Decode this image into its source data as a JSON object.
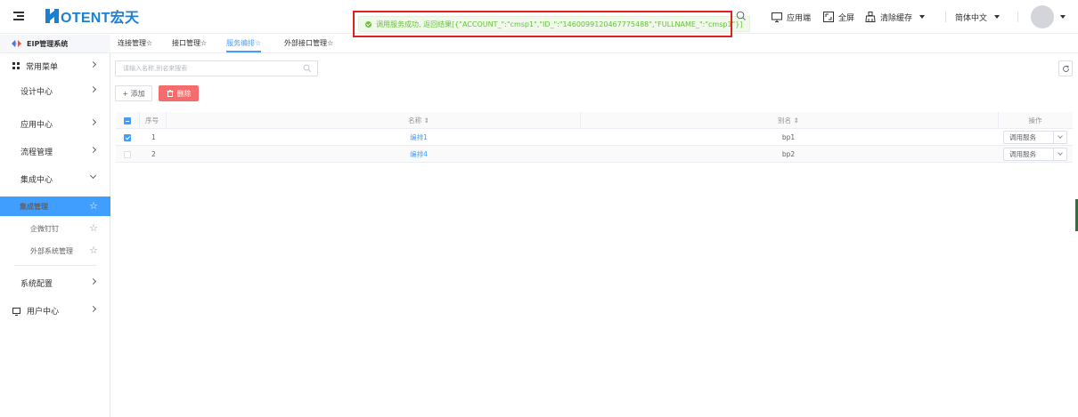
{
  "header": {
    "logo_text": "OTENT宏天",
    "toast_text": "调用服务成功, 返回结果[{\"ACCOUNT_\":\"cmsp1\",\"ID_\":\"1460099120467775488\",\"FULLNAME_\":\"cmsp1\"}]",
    "app_client_label": "应用端",
    "fullscreen_label": "全屏",
    "clear_cache_label": "清除缓存",
    "language_label": "简体中文"
  },
  "sidebar": {
    "system_title": "EIP管理系统",
    "items": [
      {
        "label": "常用菜单"
      },
      {
        "label": "设计中心"
      },
      {
        "label": "应用中心"
      },
      {
        "label": "流程管理"
      },
      {
        "label": "集成中心"
      },
      {
        "label": "集成管理"
      },
      {
        "label": "企微钉钉"
      },
      {
        "label": "外部系统管理"
      },
      {
        "label": "系统配置"
      },
      {
        "label": "用户中心"
      }
    ]
  },
  "tabs": [
    {
      "label": "连接管理☆"
    },
    {
      "label": "接口管理☆"
    },
    {
      "label": "服务编排☆"
    },
    {
      "label": "外部接口管理☆"
    }
  ],
  "toolbar": {
    "search_placeholder": "请输入名称,别名来搜索",
    "add_label": "+ 添加",
    "delete_label": "删除"
  },
  "table": {
    "columns": [
      "序号",
      "名称 ⇕",
      "别名 ⇕",
      "操作"
    ],
    "rows": [
      {
        "index": "1",
        "name": "编排1",
        "alias": "bp1",
        "action": "调用服务",
        "checked": true
      },
      {
        "index": "2",
        "name": "编排4",
        "alias": "bp2",
        "action": "调用服务",
        "checked": false
      }
    ]
  },
  "colors": {
    "primary": "#409eff",
    "danger": "#f56c6c",
    "success": "#67c23a",
    "highlight_border": "#e02020",
    "logo": "#1a7fd6"
  }
}
